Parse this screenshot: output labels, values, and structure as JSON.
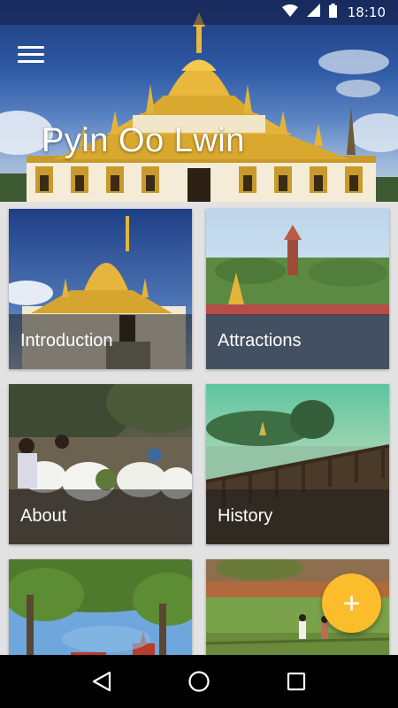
{
  "status_bar": {
    "time": "18:10",
    "icons": [
      "wifi-icon",
      "signal-icon",
      "battery-icon"
    ]
  },
  "header": {
    "title": "Pyin Oo Lwin",
    "menu_icon": "hamburger-menu-icon"
  },
  "cards": [
    {
      "label": "Introduction",
      "image": "golden-pagoda-photo"
    },
    {
      "label": "Attractions",
      "image": "lake-pagoda-tower-photo"
    },
    {
      "label": "About",
      "image": "flower-vendors-photo"
    },
    {
      "label": "History",
      "image": "lakeside-boardwalk-photo"
    },
    {
      "label": "",
      "image": "tree-church-photo"
    },
    {
      "label": "",
      "image": "farm-field-photo"
    }
  ],
  "fab": {
    "symbol": "+",
    "icon": "add-icon"
  },
  "nav": {
    "back": "back-icon",
    "home": "home-icon",
    "recents": "recents-icon"
  },
  "colors": {
    "fab": "#fbbd2c",
    "status_bar": "#1e2d5a",
    "nav_bar": "#000000"
  }
}
